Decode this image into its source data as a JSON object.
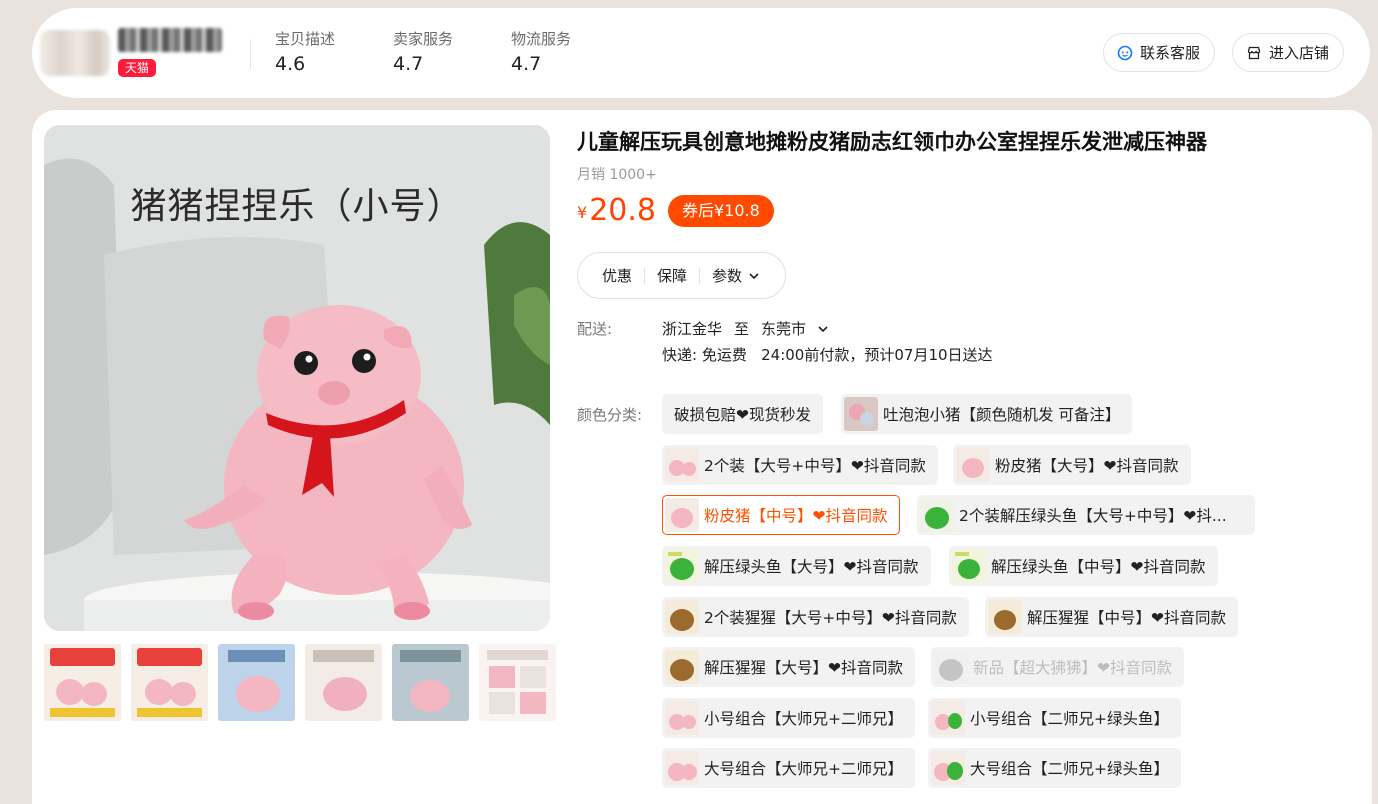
{
  "shop": {
    "badge": "天猫",
    "scores": [
      {
        "label": "宝贝描述",
        "value": "4.6"
      },
      {
        "label": "卖家服务",
        "value": "4.7"
      },
      {
        "label": "物流服务",
        "value": "4.7"
      }
    ],
    "contact_label": "联系客服",
    "enter_label": "进入店铺"
  },
  "gallery": {
    "main_image_text": "猪猪捏捏乐（小号）",
    "thumb_count": 6
  },
  "product": {
    "title": "儿童解压玩具创意地摊粉皮猪励志红领巾办公室捏捏乐发泄减压神器",
    "sales": "月销 1000+",
    "currency": "¥",
    "price": "20.8",
    "coupon": "券后¥10.8",
    "tabs": [
      "优惠",
      "保障",
      "参数"
    ]
  },
  "delivery": {
    "label": "配送:",
    "from": "浙江金华",
    "to_word": "至",
    "to": "东莞市",
    "express_line": "快递: 免运费   24:00前付款，预计07月10日送达"
  },
  "sku": {
    "label": "颜色分类:",
    "options": [
      "破损包赔❤现货秒发",
      "吐泡泡小猪【颜色随机发 可备注】",
      "2个装【大号+中号】❤抖音同款",
      "粉皮猪【大号】❤抖音同款",
      "粉皮猪【中号】❤抖音同款",
      "2个装解压绿头鱼【大号+中号】❤抖...",
      "解压绿头鱼【大号】❤抖音同款",
      "解压绿头鱼【中号】❤抖音同款",
      "2个装猩猩【大号+中号】❤抖音同款",
      "解压猩猩【中号】❤抖音同款",
      "解压猩猩【大号】❤抖音同款",
      "新品【超大狒狒】❤抖音同款",
      "小号组合【大师兄+二师兄】",
      "小号组合【二师兄+绿头鱼】",
      "大号组合【大师兄+二师兄】",
      "大号组合【二师兄+绿头鱼】"
    ],
    "selected_index": 4,
    "disabled_index": 11
  },
  "colors": {
    "accent": "#ff5000",
    "price": "#ff4400",
    "tmall": "#ff1b3a"
  }
}
